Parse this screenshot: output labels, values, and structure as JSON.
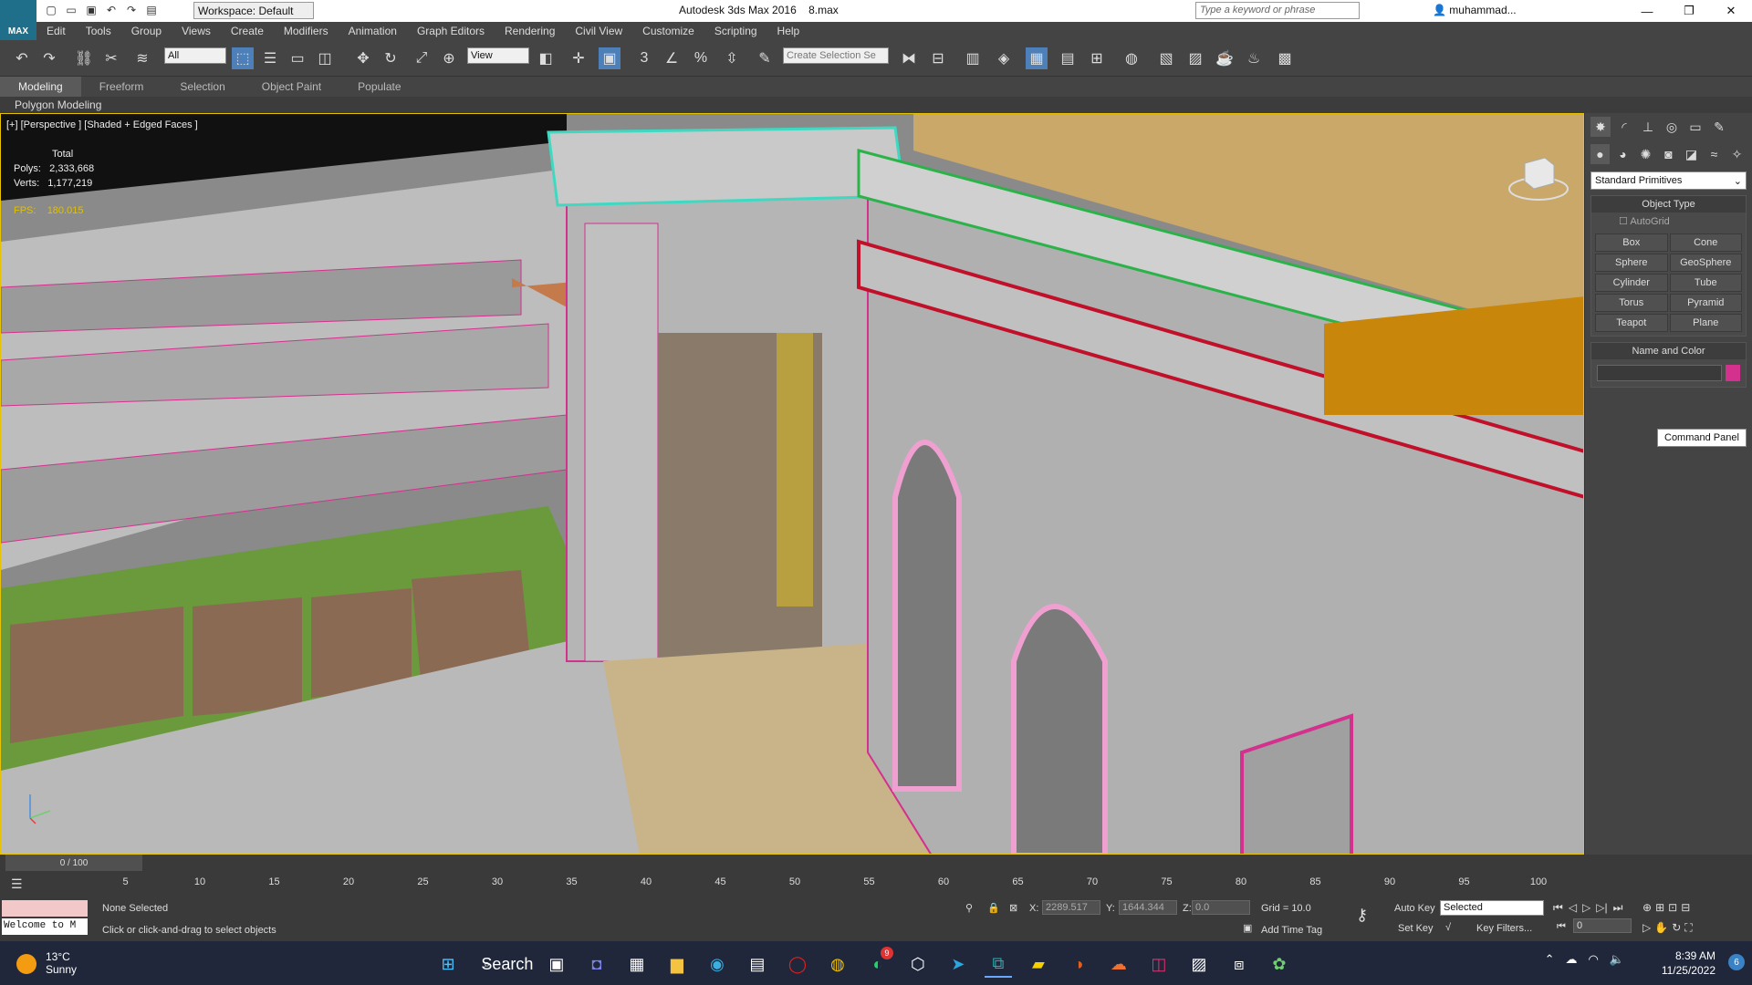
{
  "titlebar": {
    "logo": "MAX",
    "workspace": "Workspace: Default",
    "app_title": "Autodesk 3ds Max 2016",
    "file_name": "8.max",
    "search_placeholder": "Type a keyword or phrase",
    "user": "muhammad..."
  },
  "menu": [
    "Edit",
    "Tools",
    "Group",
    "Views",
    "Create",
    "Modifiers",
    "Animation",
    "Graph Editors",
    "Rendering",
    "Civil View",
    "Customize",
    "Scripting",
    "Help"
  ],
  "toolbar": {
    "filter": "All",
    "ref_coord": "View",
    "selection_set_placeholder": "Create Selection Se"
  },
  "ribbon": {
    "tabs": [
      "Modeling",
      "Freeform",
      "Selection",
      "Object Paint",
      "Populate"
    ],
    "sub_label": "Polygon Modeling"
  },
  "viewport": {
    "label": "[+] [Perspective ] [Shaded + Edged Faces ]",
    "total_label": "Total",
    "polys_label": "Polys:",
    "polys_value": "2,333,668",
    "verts_label": "Verts:",
    "verts_value": "1,177,219",
    "fps_label": "FPS:",
    "fps_value": "180.015"
  },
  "command_panel": {
    "category": "Standard Primitives",
    "object_type_title": "Object Type",
    "autogrid": "AutoGrid",
    "buttons": [
      "Box",
      "Cone",
      "Sphere",
      "GeoSphere",
      "Cylinder",
      "Tube",
      "Torus",
      "Pyramid",
      "Teapot",
      "Plane"
    ],
    "name_color_title": "Name and Color",
    "tooltip": "Command Panel",
    "swatch_color": "#d4308e"
  },
  "timeline": {
    "slider": "0 / 100",
    "ticks": [
      "5",
      "10",
      "15",
      "20",
      "25",
      "30",
      "35",
      "40",
      "45",
      "50",
      "55",
      "60",
      "65",
      "70",
      "75",
      "80",
      "85",
      "90",
      "95",
      "100"
    ]
  },
  "status": {
    "welcome": "Welcome to M",
    "selection": "None Selected",
    "prompt": "Click or click-and-drag to select objects",
    "x_label": "X:",
    "x_value": "2289.517",
    "y_label": "Y:",
    "y_value": "1644.344",
    "z_label": "Z:",
    "z_value": "0.0",
    "grid": "Grid = 10.0",
    "auto_key": "Auto Key",
    "set_key": "Set Key",
    "key_mode": "Selected",
    "add_time_tag": "Add Time Tag",
    "key_filters": "Key Filters...",
    "frame": "0"
  },
  "taskbar": {
    "temperature": "13°C",
    "weather": "Sunny",
    "search": "Search",
    "time": "8:39 AM",
    "date": "11/25/2022",
    "notifications": "6",
    "whatsapp_badge": "9"
  }
}
